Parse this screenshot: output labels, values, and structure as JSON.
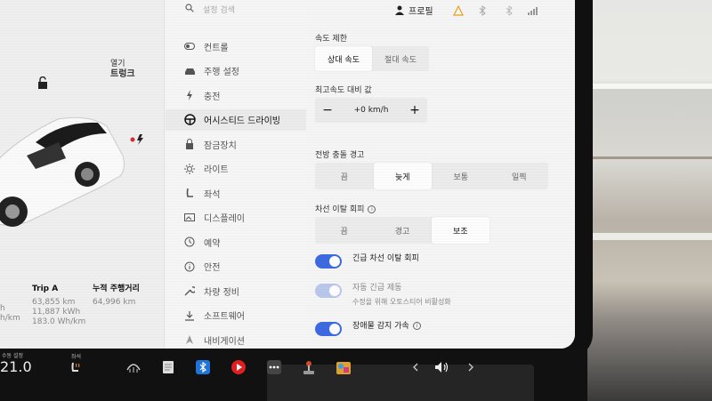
{
  "car_panel": {
    "open_label": "열기",
    "trunk_label": "트렁크",
    "trip_a": {
      "title": "Trip A",
      "line1": "63,855 km",
      "line2": "11,887 kWh",
      "line3": "183.0 Wh/km"
    },
    "odometer": {
      "title": "누적 주행거리",
      "value": "64,996 km"
    },
    "partial_left": {
      "line1": "h",
      "line2": "h/km"
    }
  },
  "search": {
    "placeholder": "설정 검색"
  },
  "nav": {
    "items": [
      {
        "label": "컨트롤",
        "icon": "toggle-icon"
      },
      {
        "label": "주행 설정",
        "icon": "car-icon"
      },
      {
        "label": "충전",
        "icon": "bolt-icon"
      },
      {
        "label": "어시스티드 드라이빙",
        "icon": "steering-wheel-icon",
        "active": true
      },
      {
        "label": "잠금장치",
        "icon": "lock-icon"
      },
      {
        "label": "라이트",
        "icon": "light-icon"
      },
      {
        "label": "좌석",
        "icon": "seat-icon"
      },
      {
        "label": "디스플레이",
        "icon": "display-icon"
      },
      {
        "label": "예약",
        "icon": "clock-icon"
      },
      {
        "label": "안전",
        "icon": "info-circle-icon"
      },
      {
        "label": "차량 정비",
        "icon": "wrench-icon"
      },
      {
        "label": "소프트웨어",
        "icon": "download-icon"
      },
      {
        "label": "내비게이션",
        "icon": "navigation-icon"
      }
    ]
  },
  "status_bar": {
    "profile_label": "프로필"
  },
  "speed_limit": {
    "label": "속도 제한",
    "options": [
      "상대 속도",
      "절대 속도"
    ],
    "selected": 0
  },
  "speed_offset": {
    "label": "최고속도 대비 값",
    "minus": "−",
    "value": "+0 km/h",
    "plus": "+"
  },
  "fcw": {
    "label": "전방 충돌 경고",
    "options": [
      "끔",
      "늦게",
      "보통",
      "일찍"
    ],
    "selected": 1
  },
  "lane_departure": {
    "label": "차선 이탈 회피",
    "info": "i",
    "options": [
      "끔",
      "경고",
      "보조"
    ],
    "selected": 2
  },
  "toggles": [
    {
      "label": "긴급 차선 이탈 회피",
      "sub": "",
      "on": true,
      "disabled": false
    },
    {
      "label": "자동 긴급 제동",
      "sub": "수정을 위해 오토스티어 비활성화",
      "on": true,
      "disabled": true
    },
    {
      "label": "장애물 감지 가속",
      "sub": "",
      "on": true,
      "disabled": false,
      "info": "i"
    }
  ],
  "taskbar": {
    "temp_label": "수동 설정",
    "temp_value": "21.0",
    "seat_label": "좌석"
  },
  "colors": {
    "accent": "#3e6ae1",
    "screen_bg": "#f4f4f4",
    "taskbar": "#111111"
  }
}
